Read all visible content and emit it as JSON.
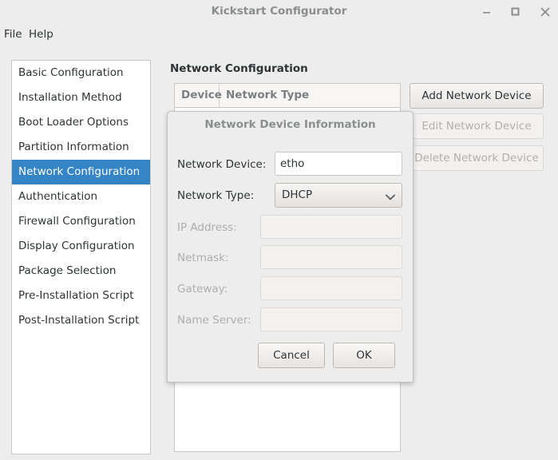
{
  "window": {
    "title": "Kickstart Configurator",
    "controls": {
      "minimize": "minimize-icon",
      "maximize": "maximize-icon",
      "close": "close-icon"
    }
  },
  "menubar": {
    "items": [
      {
        "label": "File"
      },
      {
        "label": "Help"
      }
    ]
  },
  "sidebar": {
    "items": [
      {
        "label": "Basic Configuration",
        "selected": false
      },
      {
        "label": "Installation Method",
        "selected": false
      },
      {
        "label": "Boot Loader Options",
        "selected": false
      },
      {
        "label": "Partition Information",
        "selected": false
      },
      {
        "label": "Network Configuration",
        "selected": true
      },
      {
        "label": "Authentication",
        "selected": false
      },
      {
        "label": "Firewall Configuration",
        "selected": false
      },
      {
        "label": "Display Configuration",
        "selected": false
      },
      {
        "label": "Package Selection",
        "selected": false
      },
      {
        "label": "Pre-Installation Script",
        "selected": false
      },
      {
        "label": "Post-Installation Script",
        "selected": false
      }
    ]
  },
  "main": {
    "title": "Network Configuration",
    "table": {
      "columns": [
        "Device",
        "Network Type"
      ],
      "rows": []
    },
    "buttons": [
      {
        "label": "Add Network Device",
        "enabled": true
      },
      {
        "label": "Edit Network Device",
        "enabled": false
      },
      {
        "label": "Delete Network Device",
        "enabled": false
      }
    ]
  },
  "dialog": {
    "title": "Network Device Information",
    "fields": {
      "device": {
        "label": "Network Device:",
        "value": "etho",
        "enabled": true
      },
      "type": {
        "label": "Network Type:",
        "value": "DHCP",
        "enabled": true,
        "arrow": "chevron-down-icon"
      },
      "ip": {
        "label": "IP Address:",
        "value": "",
        "enabled": false
      },
      "netmask": {
        "label": "Netmask:",
        "value": "",
        "enabled": false
      },
      "gateway": {
        "label": "Gateway:",
        "value": "",
        "enabled": false
      },
      "nameserver": {
        "label": "Name Server:",
        "value": "",
        "enabled": false
      }
    },
    "buttons": {
      "cancel": "Cancel",
      "ok": "OK"
    }
  },
  "colors": {
    "selection": "#3584c6",
    "window_bg": "#ededed",
    "field_bg": "#ffffff",
    "disabled_text": "#b0aeab"
  }
}
